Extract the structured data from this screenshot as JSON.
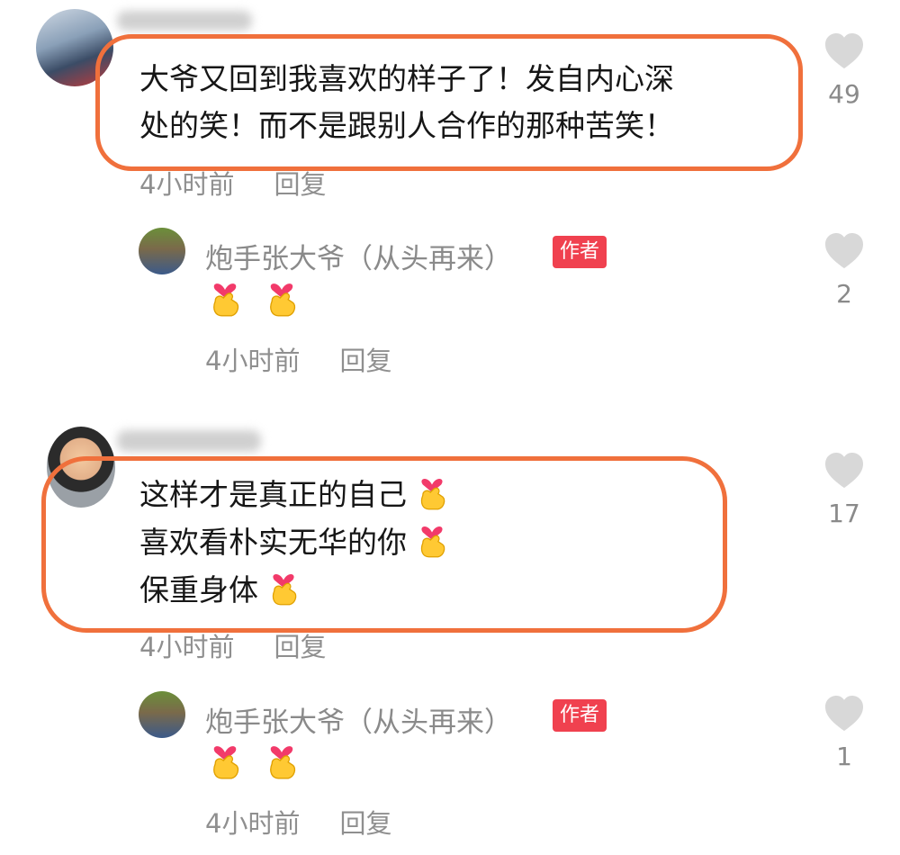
{
  "comments": [
    {
      "text_line1": "大爷又回到我喜欢的样子了！发自内心深",
      "text_line2": "处的笑！而不是跟别人合作的那种苦笑！",
      "time": "4小时前",
      "reply_label": "回复",
      "likes": "49",
      "reply": {
        "author": "炮手张大爷（从头再来）",
        "badge": "作者",
        "time": "4小时前",
        "reply_label": "回复",
        "likes": "2"
      }
    },
    {
      "text_line1": "这样才是真正的自己",
      "text_line2": "喜欢看朴实无华的你",
      "text_line3": "保重身体",
      "time": "4小时前",
      "reply_label": "回复",
      "likes": "17",
      "reply": {
        "author": "炮手张大爷（从头再来）",
        "badge": "作者",
        "time": "4小时前",
        "reply_label": "回复",
        "likes": "1"
      }
    }
  ],
  "colors": {
    "highlight": "#f0703c",
    "badge": "#f0414f",
    "heart": "#d8d8d8"
  },
  "icons": [
    "heart-icon",
    "finger-heart-emoji"
  ]
}
